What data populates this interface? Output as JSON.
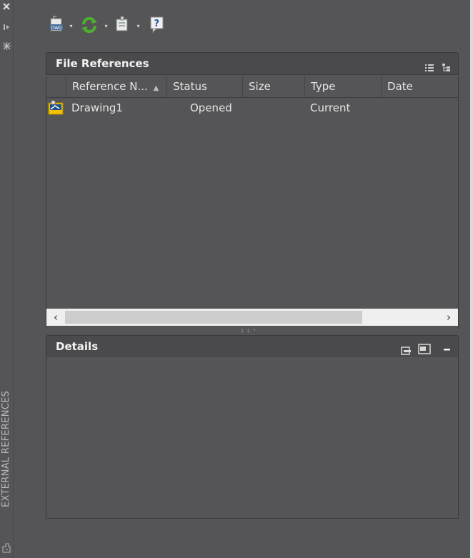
{
  "sidebar": {
    "vertical_title": "EXTERNAL REFERENCES",
    "icons": [
      "close-icon",
      "auto-hide-icon",
      "properties-icon",
      "xref-palette-icon"
    ]
  },
  "toolbar": {
    "items": [
      "attach-dwg-icon",
      "refresh-icon",
      "change-path-icon",
      "help-icon"
    ]
  },
  "file_references": {
    "title": "File References",
    "view_icons": [
      "list-view-icon",
      "tree-view-icon"
    ],
    "columns": [
      "Reference N...",
      "Status",
      "Size",
      "Type",
      "Date"
    ],
    "sort_indicator": "▲",
    "rows": [
      {
        "name": "Drawing1",
        "status": "Opened",
        "size": "",
        "type": "Current",
        "date": ""
      }
    ]
  },
  "details": {
    "title": "Details",
    "icons": [
      "details-icon",
      "preview-icon",
      "collapse-icon"
    ]
  },
  "colors": {
    "panel_bg": "#555557",
    "title_bg": "#4a4a4c",
    "text": "#e6e6e6",
    "refresh_green": "#4caf2e"
  }
}
